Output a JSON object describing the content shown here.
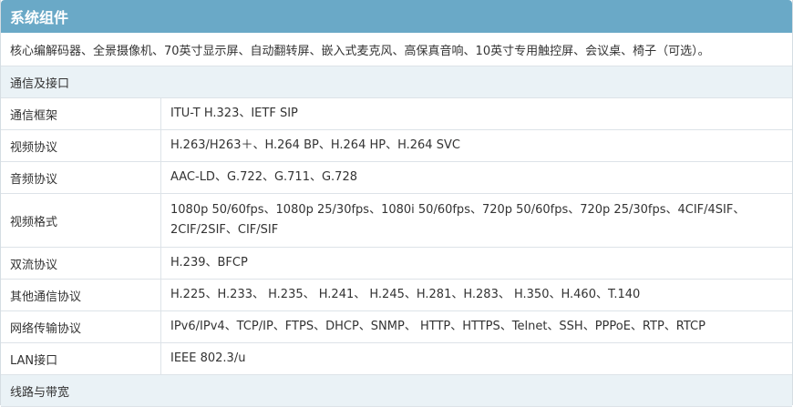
{
  "header": {
    "title": "系统组件"
  },
  "intro": "核心编解码器、全景摄像机、70英寸显示屏、自动翻转屏、嵌入式麦克风、高保真音响、10英寸专用触控屏、会议桌、椅子（可选）。",
  "sections": [
    {
      "heading": "通信及接口",
      "rows": [
        {
          "label": "通信框架",
          "value": "ITU-T H.323、IETF SIP"
        },
        {
          "label": "视频协议",
          "value": "H.263/H263＋、H.264 BP、H.264 HP、H.264 SVC"
        },
        {
          "label": "音频协议",
          "value": "AAC-LD、G.722、G.711、G.728"
        },
        {
          "label": "视频格式",
          "value": "1080p 50/60fps、1080p 25/30fps、1080i 50/60fps、720p 50/60fps、720p 25/30fps、4CIF/4SIF、2CIF/2SIF、CIF/SIF"
        },
        {
          "label": "双流协议",
          "value": "H.239、BFCP"
        },
        {
          "label": "其他通信协议",
          "value": "H.225、H.233、 H.235、 H.241、 H.245、H.281、H.283、 H.350、H.460、T.140"
        },
        {
          "label": "网络传输协议",
          "value": "IPv6/IPv4、TCP/IP、FTPS、DHCP、SNMP、 HTTP、HTTPS、Telnet、SSH、PPPoE、RTP、RTCP"
        },
        {
          "label": "LAN接口",
          "value": "IEEE 802.3/u"
        }
      ]
    },
    {
      "heading": "线路与带宽"
    }
  ]
}
